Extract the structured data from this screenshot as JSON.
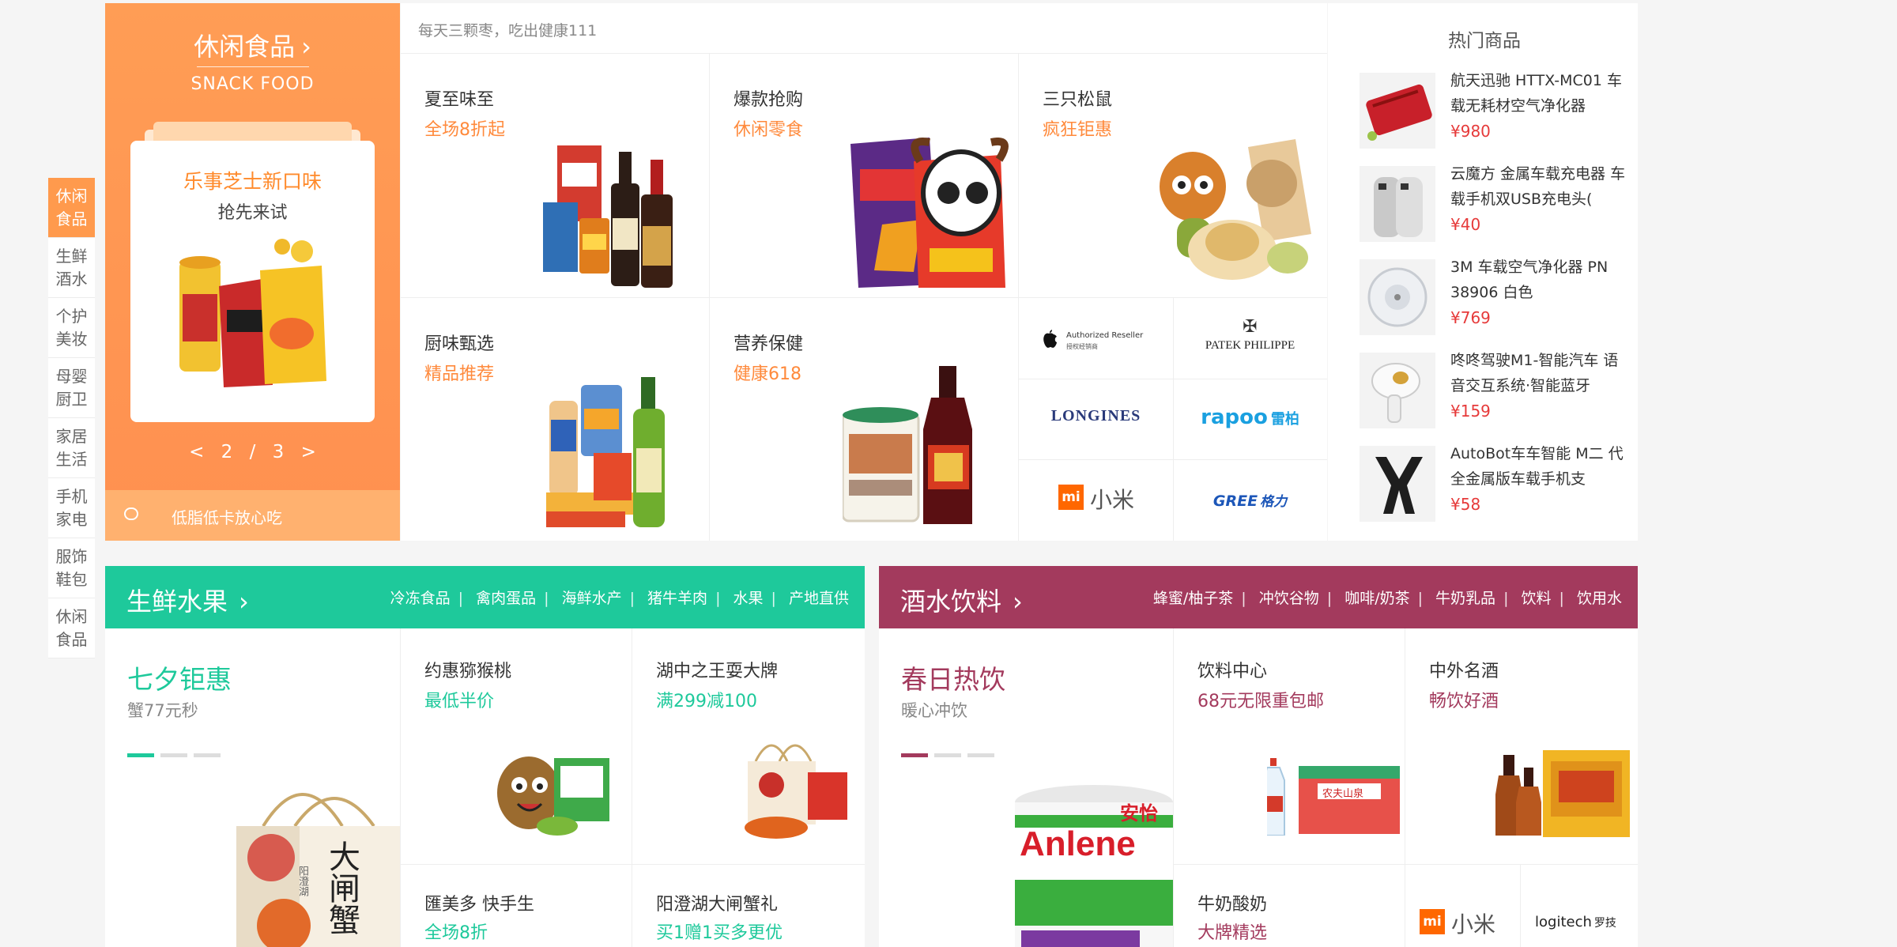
{
  "side_nav": [
    {
      "label": "休闲食品",
      "active": true
    },
    {
      "label": "生鲜酒水",
      "active": false
    },
    {
      "label": "个护美妆",
      "active": false
    },
    {
      "label": "母婴厨卫",
      "active": false
    },
    {
      "label": "家居生活",
      "active": false
    },
    {
      "label": "手机家电",
      "active": false
    },
    {
      "label": "服饰鞋包",
      "active": false
    },
    {
      "label": "休闲食品",
      "active": false
    }
  ],
  "snack": {
    "title": "休闲食品",
    "title_en": "SNACK FOOD",
    "card_title": "乐事芝士新口味",
    "card_sub": "抢先来试",
    "pager_prev": "<",
    "pager_text": "2 / 3",
    "pager_next": ">",
    "foot_text": "低脂低卡放心吃"
  },
  "grid": {
    "notice": "每天三颗枣，吃出健康111",
    "cells": [
      {
        "title": "夏至味至",
        "sub": "全场8折起"
      },
      {
        "title": "爆款抢购",
        "sub": "休闲零食"
      },
      {
        "title": "三只松鼠",
        "sub": "疯狂钜惠"
      },
      {
        "title": "厨味甄选",
        "sub": "精品推荐"
      },
      {
        "title": "营养保健",
        "sub": "健康618"
      }
    ],
    "brands": {
      "apple_1": "Authorized Reseller",
      "apple_2": "授权经销商",
      "patek": "PATEK PHILIPPE",
      "longines": "LONGINES",
      "rapoo": "rapoo",
      "rapoo_cn": "雷柏",
      "mi_logo": "mi",
      "mi": "小米",
      "gree": "GREE",
      "gree_cn": "格力"
    }
  },
  "hot": {
    "title": "热门商品",
    "items": [
      {
        "name": "航天迅驰 HTTX-MC01 车载无耗材空气净化器",
        "price": "¥980"
      },
      {
        "name": "云魔方 金属车载充电器 车载手机双USB充电头(",
        "price": "¥40"
      },
      {
        "name": "3M 车载空气净化器 PN 38906 白色",
        "price": "¥769"
      },
      {
        "name": "咚咚驾驶M1-智能汽车 语音交互系统·智能蓝牙",
        "price": "¥159"
      },
      {
        "name": "AutoBot车车智能 M二 代全金属版车载手机支",
        "price": "¥58"
      }
    ]
  },
  "fresh": {
    "color": "#1ec99b",
    "title": "生鲜水果",
    "links": [
      "冷冻食品",
      "禽肉蛋品",
      "海鲜水产",
      "猪牛羊肉",
      "水果",
      "产地直供"
    ],
    "feature_title": "七夕钜惠",
    "feature_sub": "蟹77元秒",
    "cells": [
      {
        "title": "约惠猕猴桃",
        "sub": "最低半价"
      },
      {
        "title": "湖中之王耍大牌",
        "sub": "满299减100"
      },
      {
        "title": "匯美多 快手生",
        "sub": "全场8折"
      },
      {
        "title": "阳澄湖大闸蟹礼",
        "sub": "买1赠1买多更优"
      }
    ],
    "crab_text": "大闸蟹",
    "crab_small": "阳澄湖"
  },
  "drinks": {
    "color": "#a33a5d",
    "title": "酒水饮料",
    "links": [
      "蜂蜜/柚子茶",
      "冲饮谷物",
      "咖啡/奶茶",
      "牛奶乳品",
      "饮料",
      "饮用水"
    ],
    "feature_title": "春日热饮",
    "feature_sub": "暖心冲饮",
    "cells": [
      {
        "title": "饮料中心",
        "sub": "68元无限重包邮"
      },
      {
        "title": "中外名酒",
        "sub": "畅饮好酒"
      },
      {
        "title": "牛奶酸奶",
        "sub": "大牌精选"
      }
    ],
    "anlene": "Anlene",
    "anlene_cn": "安怡",
    "water_cn": "农夫山泉",
    "mi_logo": "mi",
    "mi": "小米",
    "logitech": "logitech",
    "logitech_cn": "罗技"
  }
}
